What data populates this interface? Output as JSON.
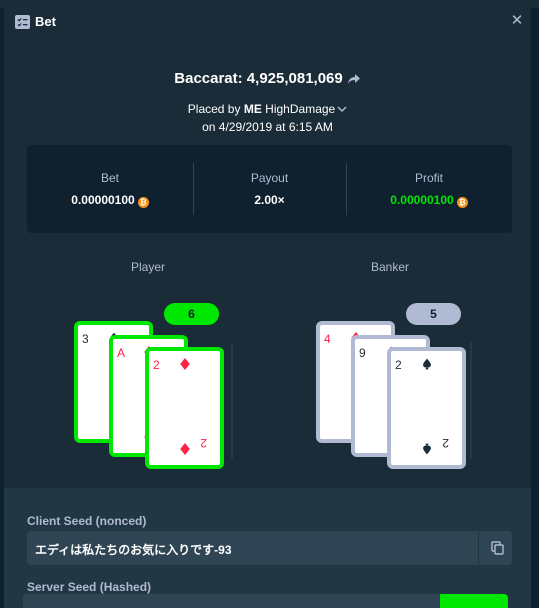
{
  "header": {
    "title": "Bet",
    "icon": "bet-list-icon",
    "close_icon": "close-icon"
  },
  "game": {
    "title": "Baccarat: 4,925,081,069",
    "share_icon": "share-arrow-icon"
  },
  "placed": {
    "prefix": "Placed by",
    "badge": "ME",
    "user": "HighDamage",
    "date": "on 4/29/2019 at 6:15 AM"
  },
  "stats": {
    "bet_label": "Bet",
    "bet_value": "0.00000100",
    "payout_label": "Payout",
    "payout_value": "2.00×",
    "profit_label": "Profit",
    "profit_value": "0.00000100",
    "currency_icon": "bitcoin-icon"
  },
  "player": {
    "label": "Player",
    "score": "6",
    "cards": [
      {
        "rank": "3",
        "suit": "spade"
      },
      {
        "rank": "A",
        "suit": "diamond"
      },
      {
        "rank": "2",
        "suit": "diamond"
      }
    ]
  },
  "banker": {
    "label": "Banker",
    "score": "5",
    "cards": [
      {
        "rank": "4",
        "suit": "diamond"
      },
      {
        "rank": "9",
        "suit": "spade"
      },
      {
        "rank": "2",
        "suit": "spade"
      }
    ]
  },
  "seeds": {
    "client_label": "Client Seed (nonced)",
    "client_value": "エディは私たちのお気に入りです-93",
    "server_label": "Server Seed (Hashed)"
  },
  "colors": {
    "win": "#00e701",
    "lose": "#b1bad3",
    "red_suit": "#fe2247",
    "black_suit": "#1a2c38"
  }
}
